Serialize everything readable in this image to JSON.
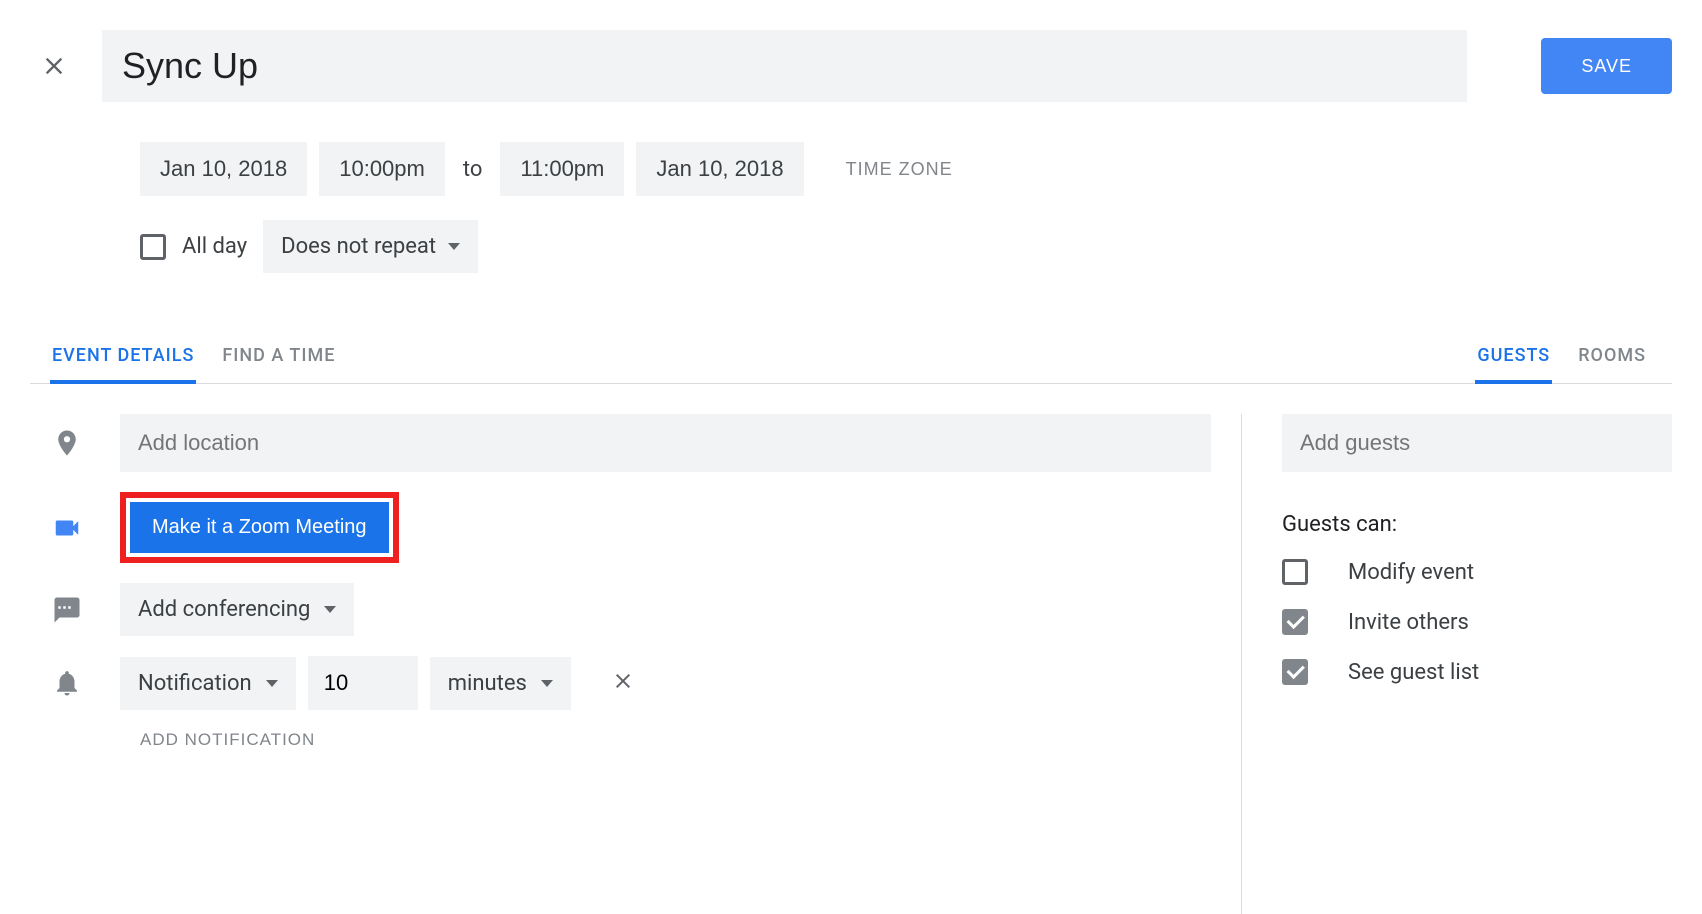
{
  "header": {
    "title_value": "Sync Up",
    "save_label": "SAVE"
  },
  "datetime": {
    "start_date": "Jan 10, 2018",
    "start_time": "10:00pm",
    "to_label": "to",
    "end_time": "11:00pm",
    "end_date": "Jan 10, 2018",
    "timezone_label": "TIME ZONE"
  },
  "allday": {
    "label": "All day",
    "repeat_label": "Does not repeat"
  },
  "tabs": {
    "left": [
      {
        "label": "EVENT DETAILS",
        "active": true
      },
      {
        "label": "FIND A TIME",
        "active": false
      }
    ],
    "right": [
      {
        "label": "GUESTS",
        "active": true
      },
      {
        "label": "ROOMS",
        "active": false
      }
    ]
  },
  "details": {
    "location_placeholder": "Add location",
    "zoom_button_label": "Make it a Zoom Meeting",
    "conferencing_label": "Add conferencing",
    "notification": {
      "type_label": "Notification",
      "value": "10",
      "unit_label": "minutes"
    },
    "add_notification_label": "ADD NOTIFICATION"
  },
  "guests": {
    "add_guests_placeholder": "Add guests",
    "can_title": "Guests can:",
    "permissions": [
      {
        "label": "Modify event",
        "checked": false
      },
      {
        "label": "Invite others",
        "checked": true
      },
      {
        "label": "See guest list",
        "checked": true
      }
    ]
  }
}
